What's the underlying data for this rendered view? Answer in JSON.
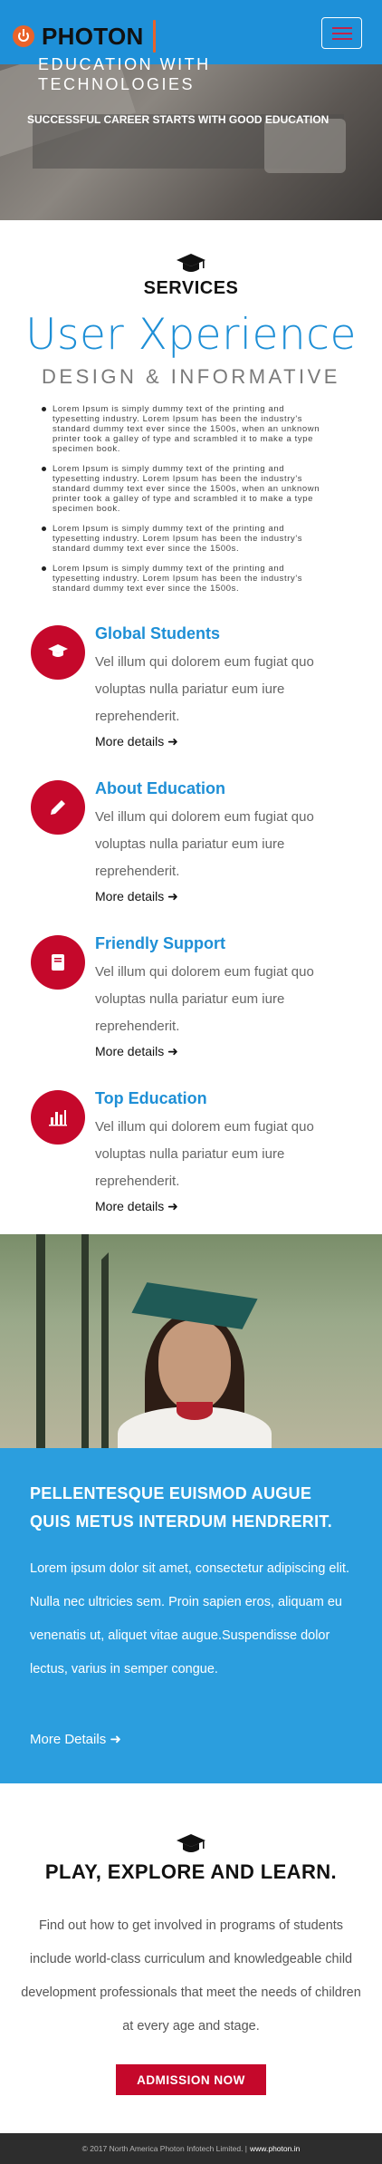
{
  "header": {
    "logo_text": "PHOTON",
    "menu_label": "menu"
  },
  "hero": {
    "title": "EDUCATION WITH TECHNOLOGIES",
    "subtitle": "SUCCESSFUL CAREER STARTS WITH GOOD EDUCATION"
  },
  "services": {
    "title": "SERVICES",
    "headline": "User Xperience",
    "subheadline": "DESIGN & INFORMATIVE",
    "bullets": [
      "Lorem Ipsum is simply dummy text of the printing and typesetting industry. Lorem Ipsum has been the industry's standard dummy text ever since the 1500s, when an unknown printer took a galley of type and scrambled it to make a type specimen book.",
      "Lorem Ipsum is simply dummy text of the printing and typesetting industry. Lorem Ipsum has been the industry's standard dummy text ever since the 1500s, when an unknown printer took a galley of type and scrambled it to make a type specimen book.",
      "Lorem Ipsum is simply dummy text of the printing and typesetting industry. Lorem Ipsum has been the industry's standard dummy text ever since the 1500s.",
      "Lorem Ipsum is simply dummy text of the printing and typesetting industry. Lorem Ipsum has been the industry's standard dummy text ever since the 1500s."
    ],
    "features": [
      {
        "title": "Global Students",
        "text": "Vel illum qui dolorem eum fugiat quo voluptas nulla pariatur eum iure reprehenderit.",
        "more": "More details",
        "icon": "graduation-cap-icon"
      },
      {
        "title": "About Education",
        "text": "Vel illum qui dolorem eum fugiat quo voluptas nulla pariatur eum iure reprehenderit.",
        "more": "More details",
        "icon": "pencil-icon"
      },
      {
        "title": "Friendly Support",
        "text": "Vel illum qui dolorem eum fugiat quo voluptas nulla pariatur eum iure reprehenderit.",
        "more": "More details",
        "icon": "book-icon"
      },
      {
        "title": "Top Education",
        "text": "Vel illum qui dolorem eum fugiat quo voluptas nulla pariatur eum iure reprehenderit.",
        "more": "More details",
        "icon": "bar-chart-icon"
      }
    ]
  },
  "promo": {
    "title": "PELLENTESQUE EUISMOD AUGUE QUIS METUS INTERDUM HENDRERIT.",
    "text": "Lorem ipsum dolor sit amet, consectetur adipiscing elit. Nulla nec ultricies sem. Proin sapien eros, aliquam eu venenatis ut, aliquet vitae augue.Suspendisse dolor lectus, varius in semper congue.",
    "more": "More Details"
  },
  "play": {
    "title": "PLAY, EXPLORE AND LEARN.",
    "text": "Find out how to get involved in programs of students include world-class curriculum and knowledgeable child development professionals that meet the needs of children at every age and stage.",
    "button": "ADMISSION NOW"
  },
  "footer": {
    "copyright": "© 2017 North America Photon Infotech Limited. |",
    "link": "www.photon.in"
  },
  "colors": {
    "brand_blue": "#1e90d8",
    "accent_red": "#c5082b",
    "logo_orange": "#e9632a"
  }
}
